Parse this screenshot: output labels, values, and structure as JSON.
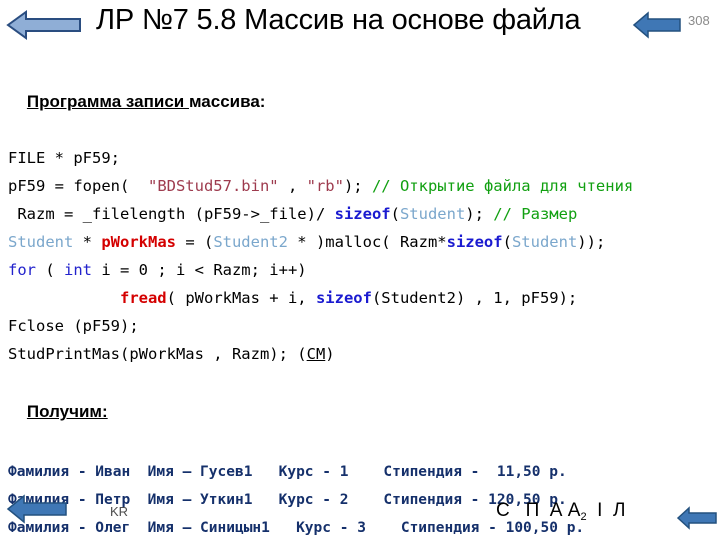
{
  "header": {
    "title": "ЛР №7 5.8 Массив на основе файла",
    "page_number": "308",
    "back_arrow_left": "left-arrow-icon",
    "back_arrow_right": "left-arrow-icon"
  },
  "colors": {
    "arrow_light_fill": "#8faed6",
    "arrow_light_stroke": "#2a4d80",
    "arrow_dark_fill": "#3f77b5",
    "arrow_dark_stroke": "#23517f",
    "keyword_blue": "#2222cc",
    "function_red": "#d40000",
    "type_lightblue": "#7ba7cc",
    "string_maroon": "#9e3b4e",
    "comment_green": "#11a011",
    "output_navy": "#15306b",
    "page_number_gray": "#8a8a8a"
  },
  "content": {
    "heading_program": {
      "underlined": "Программа записи ",
      "rest": "массива:"
    },
    "code": [
      {
        "tokens": [
          {
            "t": "FILE * pF59;",
            "c": "plain"
          }
        ]
      },
      {
        "tokens": [
          {
            "t": "pF59 = fopen(  ",
            "c": "plain"
          },
          {
            "t": "\"BDStud57.bin\"",
            "c": "str"
          },
          {
            "t": " , ",
            "c": "plain"
          },
          {
            "t": "\"rb\"",
            "c": "str"
          },
          {
            "t": "); ",
            "c": "plain"
          },
          {
            "t": "// Открытие файла для чтения",
            "c": "cmt"
          }
        ]
      },
      {
        "tokens": [
          {
            "t": " Razm = _filelength (pF59->_file)/ ",
            "c": "plain"
          },
          {
            "t": "sizeof",
            "c": "kwb"
          },
          {
            "t": "(",
            "c": "plain"
          },
          {
            "t": "Student",
            "c": "typ"
          },
          {
            "t": "); ",
            "c": "plain"
          },
          {
            "t": "// Размер",
            "c": "cmt"
          }
        ]
      },
      {
        "tokens": [
          {
            "t": "Student",
            "c": "typ"
          },
          {
            "t": " * ",
            "c": "plain"
          },
          {
            "t": "pWorkMas",
            "c": "fn"
          },
          {
            "t": " = (",
            "c": "plain"
          },
          {
            "t": "Student2",
            "c": "typ"
          },
          {
            "t": " * )malloc( Razm*",
            "c": "plain"
          },
          {
            "t": "sizeof",
            "c": "kwb"
          },
          {
            "t": "(",
            "c": "plain"
          },
          {
            "t": "Student",
            "c": "typ"
          },
          {
            "t": "));",
            "c": "plain"
          }
        ]
      },
      {
        "tokens": [
          {
            "t": "for",
            "c": "kw"
          },
          {
            "t": " ( ",
            "c": "plain"
          },
          {
            "t": "int",
            "c": "kw"
          },
          {
            "t": " i = 0 ; i < Razm; i++)",
            "c": "plain"
          }
        ]
      },
      {
        "tokens": [
          {
            "t": "            ",
            "c": "plain"
          },
          {
            "t": "fread",
            "c": "fn"
          },
          {
            "t": "( pWorkMas + i, ",
            "c": "plain"
          },
          {
            "t": "sizeof",
            "c": "kwb"
          },
          {
            "t": "(Student2) , 1, pF59);",
            "c": "plain"
          }
        ]
      },
      {
        "tokens": [
          {
            "t": "Fclose (pF59);",
            "c": "plain"
          }
        ]
      },
      {
        "tokens": [
          {
            "t": "StudPrintMas(pWorkMas , Razm); (",
            "c": "plain"
          },
          {
            "t": "СМ",
            "c": "u"
          },
          {
            "t": ")",
            "c": "plain"
          }
        ]
      }
    ],
    "heading_result": "Получим:",
    "output_rows": [
      "Фамилия - Иван  Имя – Гусев1   Курс - 1    Стипендия -  11,50 р.",
      "Фамилия - Петр  Имя – Уткин1   Курс - 2    Стипендия - 120,50 р.",
      "Фамилия - Олег  Имя – Синицын1   Курс - 3    Стипендия - 100,50 р."
    ]
  },
  "footer": {
    "left_label": "KR",
    "right_label_parts": [
      "С",
      "П",
      "А",
      "А",
      "2",
      "І",
      "Л"
    ],
    "right_label": "С   П А А",
    "right_label_tail": "І  Л"
  }
}
